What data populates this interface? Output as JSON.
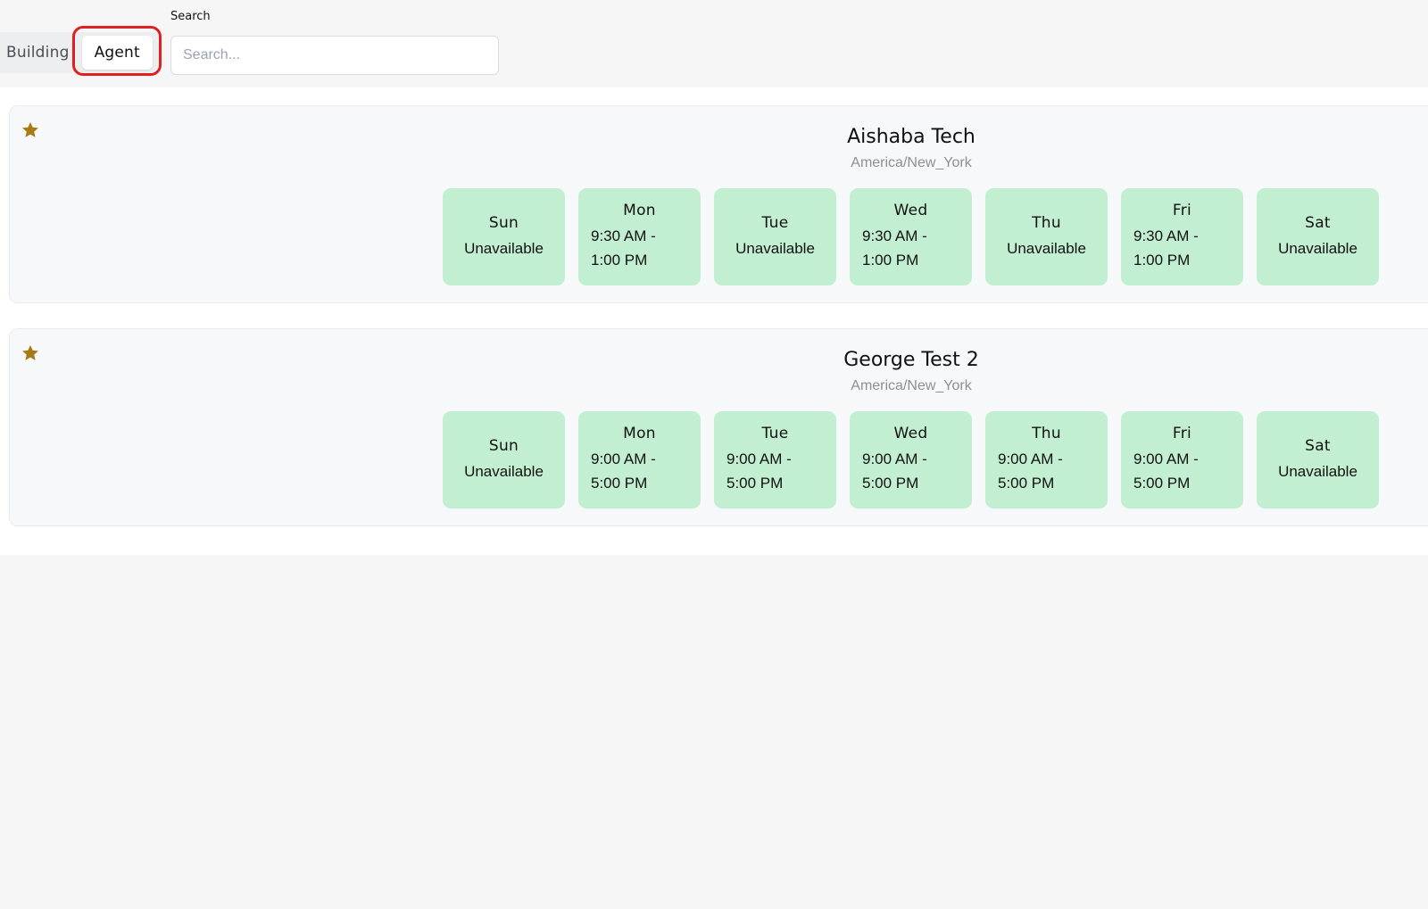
{
  "toggle": {
    "building_label": "Building",
    "agent_label": "Agent"
  },
  "search": {
    "label": "Search",
    "placeholder": "Search...",
    "value": ""
  },
  "colors": {
    "day_tile": "#c2efd1",
    "star": "#a87b12",
    "highlight": "#e02020"
  },
  "agents": [
    {
      "name": "Aishaba Tech",
      "timezone": "America/New_York",
      "favorite": true,
      "days": [
        {
          "day": "Sun",
          "line1": "Unavailable",
          "line2": ""
        },
        {
          "day": "Mon",
          "line1": "9:30 AM -",
          "line2": "1:00 PM"
        },
        {
          "day": "Tue",
          "line1": "Unavailable",
          "line2": ""
        },
        {
          "day": "Wed",
          "line1": "9:30 AM -",
          "line2": "1:00 PM"
        },
        {
          "day": "Thu",
          "line1": "Unavailable",
          "line2": ""
        },
        {
          "day": "Fri",
          "line1": "9:30 AM -",
          "line2": "1:00 PM"
        },
        {
          "day": "Sat",
          "line1": "Unavailable",
          "line2": ""
        }
      ]
    },
    {
      "name": "George Test 2",
      "timezone": "America/New_York",
      "favorite": true,
      "days": [
        {
          "day": "Sun",
          "line1": "Unavailable",
          "line2": ""
        },
        {
          "day": "Mon",
          "line1": "9:00 AM -",
          "line2": "5:00 PM"
        },
        {
          "day": "Tue",
          "line1": "9:00 AM -",
          "line2": "5:00 PM"
        },
        {
          "day": "Wed",
          "line1": "9:00 AM -",
          "line2": "5:00 PM"
        },
        {
          "day": "Thu",
          "line1": "9:00 AM -",
          "line2": "5:00 PM"
        },
        {
          "day": "Fri",
          "line1": "9:00 AM -",
          "line2": "5:00 PM"
        },
        {
          "day": "Sat",
          "line1": "Unavailable",
          "line2": ""
        }
      ]
    }
  ]
}
